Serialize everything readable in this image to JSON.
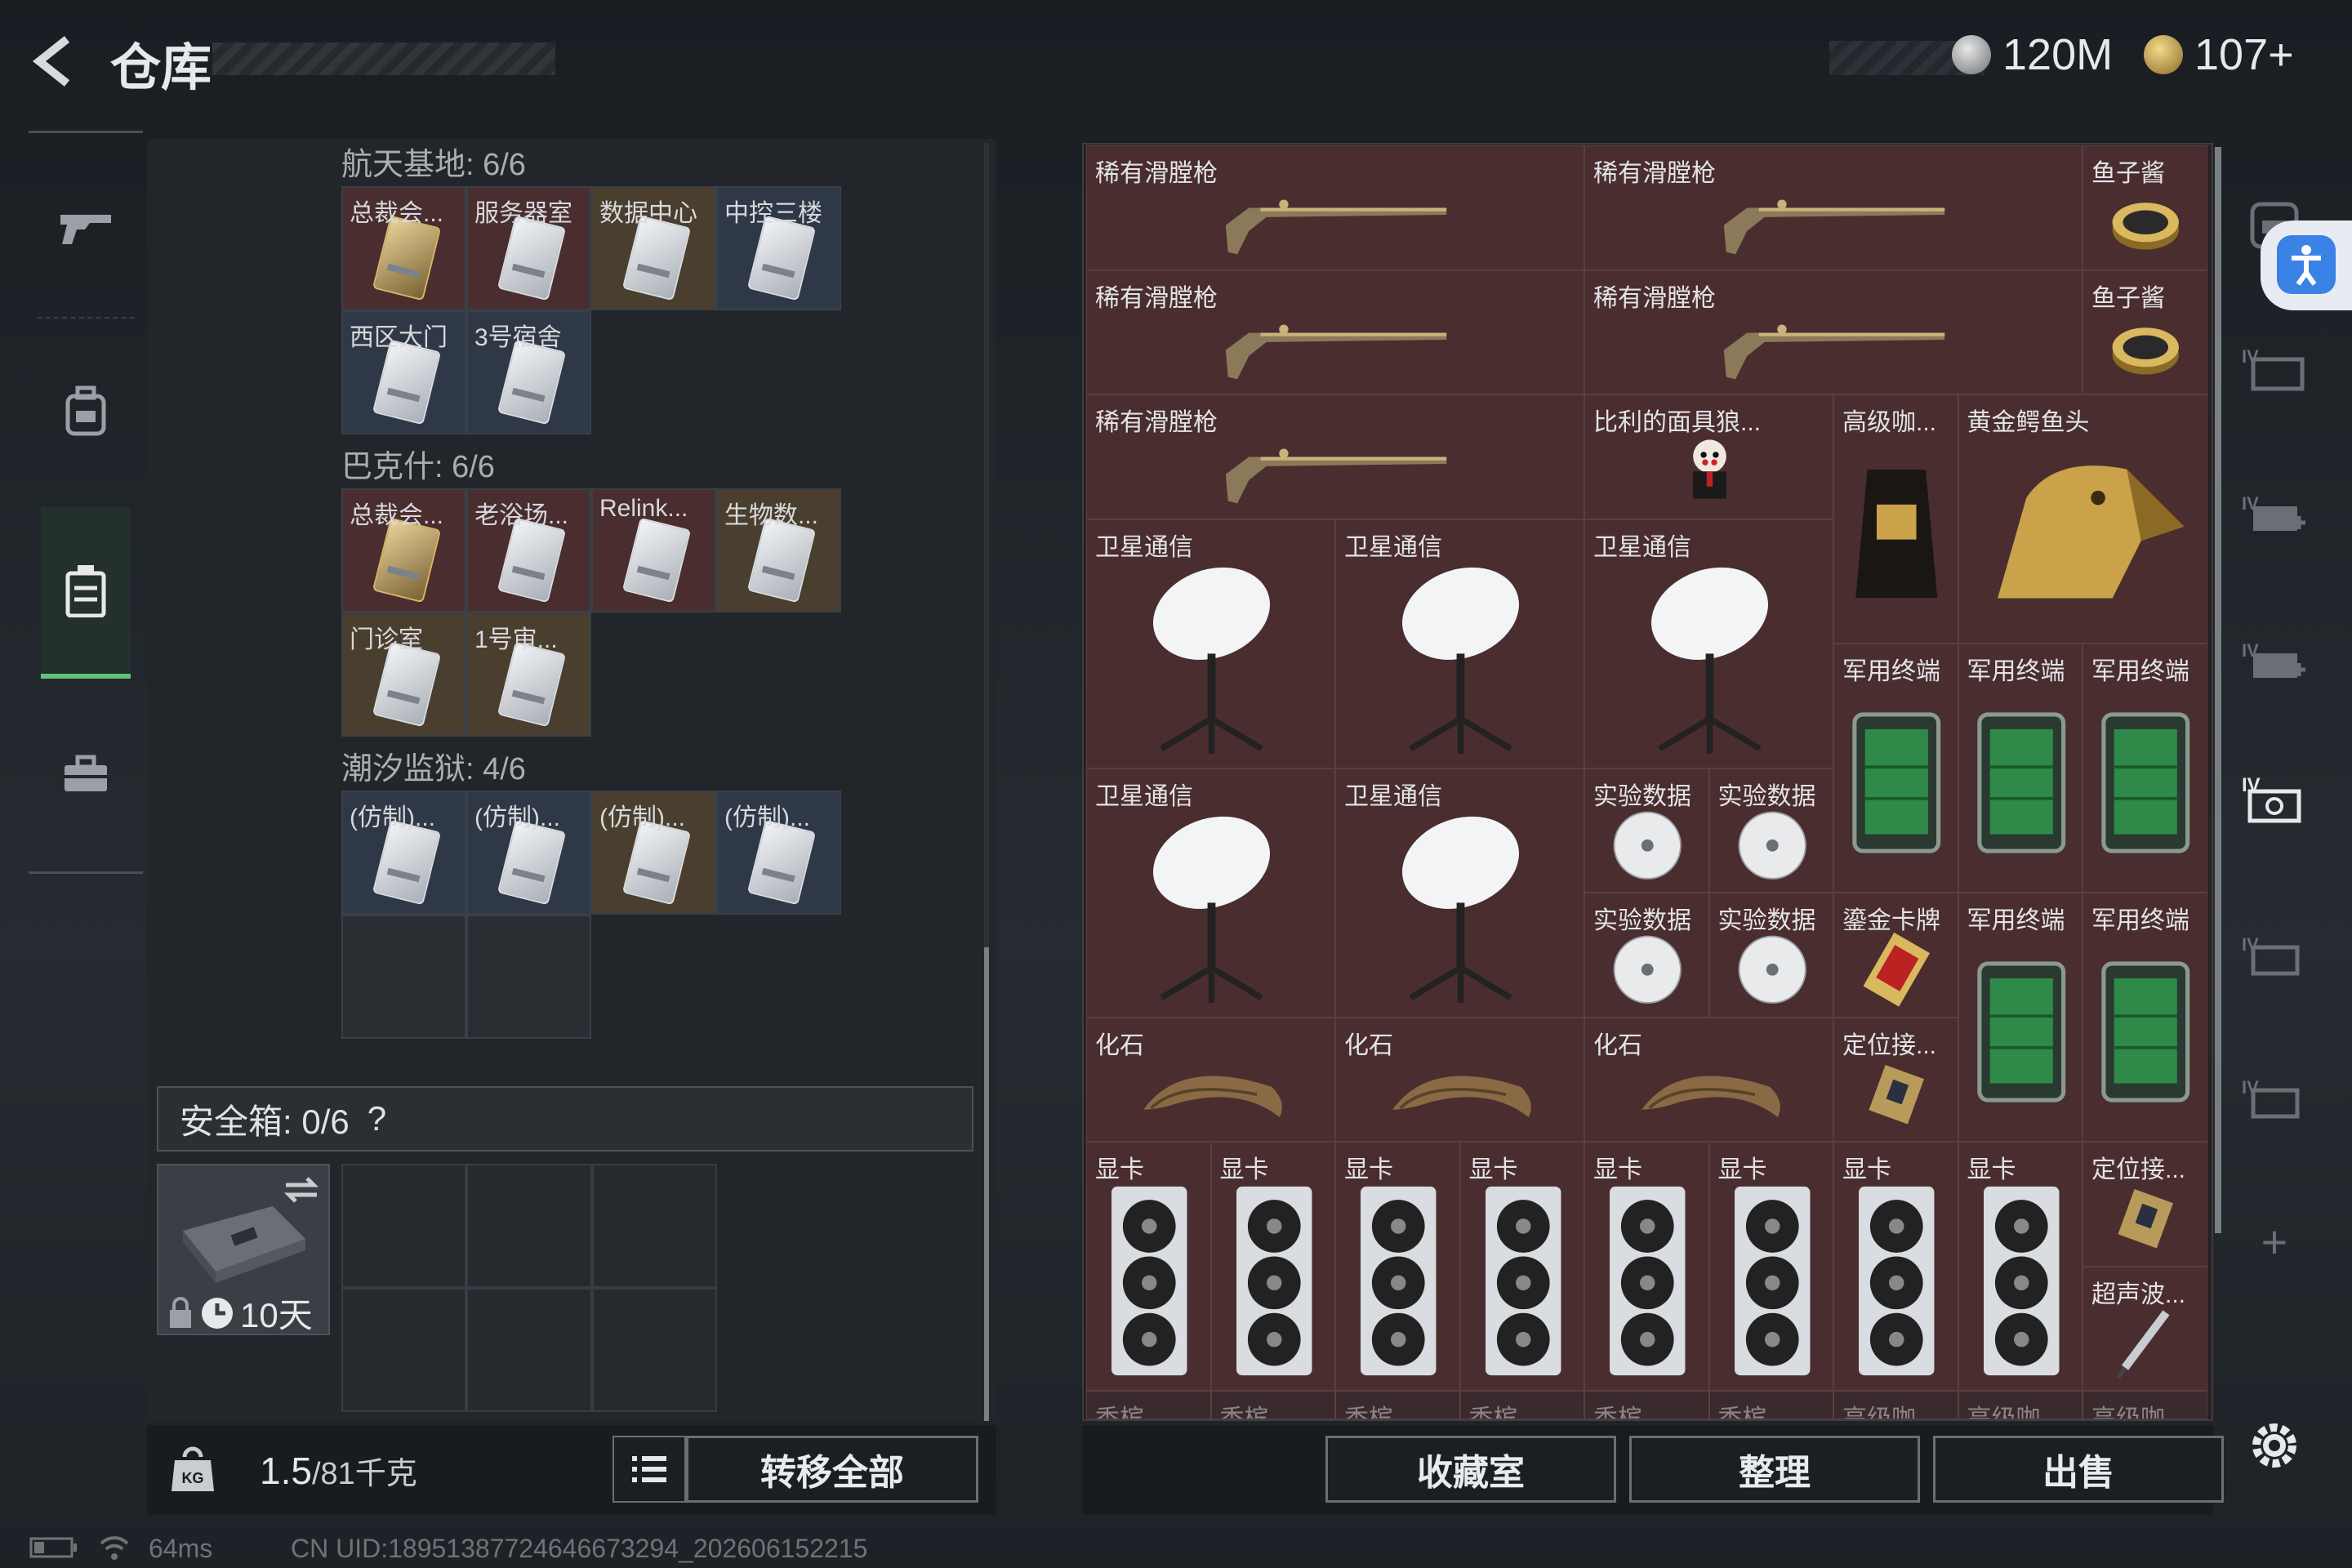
{
  "header": {
    "title": "仓库",
    "currency1": "120M",
    "currency2": "107+"
  },
  "left_nav": {
    "items": [
      "weapon-icon",
      "backpack-icon",
      "case-icon",
      "toolbox-icon"
    ]
  },
  "sections": [
    {
      "label": "航天基地: 6/6",
      "items": [
        {
          "name": "总裁会...",
          "color": "red",
          "card": "gold"
        },
        {
          "name": "服务器室",
          "color": "red",
          "card": "white"
        },
        {
          "name": "数据中心",
          "color": "gold",
          "card": "white"
        },
        {
          "name": "中控三楼",
          "color": "blue",
          "card": "white"
        },
        {
          "name": "西区大门",
          "color": "blue",
          "card": "white"
        },
        {
          "name": "3号宿舍",
          "color": "blue",
          "card": "white"
        }
      ]
    },
    {
      "label": "巴克什: 6/6",
      "items": [
        {
          "name": "总裁会...",
          "color": "red",
          "card": "gold"
        },
        {
          "name": "老浴场...",
          "color": "red",
          "card": "white"
        },
        {
          "name": "Relink...",
          "color": "red",
          "card": "white"
        },
        {
          "name": "生物数...",
          "color": "gold",
          "card": "white"
        },
        {
          "name": "门诊室",
          "color": "gold",
          "card": "white"
        },
        {
          "name": "1号审...",
          "color": "gold",
          "card": "white"
        }
      ]
    },
    {
      "label": "潮汐监狱: 4/6",
      "items": [
        {
          "name": "(仿制)...",
          "color": "blue",
          "card": "white"
        },
        {
          "name": "(仿制)...",
          "color": "blue",
          "card": "white"
        },
        {
          "name": "(仿制)...",
          "color": "gold",
          "card": "white"
        },
        {
          "name": "(仿制)...",
          "color": "blue",
          "card": "white"
        }
      ]
    }
  ],
  "safe": {
    "label": "安全箱: 0/6",
    "help": "?",
    "timer": "10天"
  },
  "weight": {
    "value": "1.5",
    "max": "/81千克"
  },
  "buttons": {
    "transfer_all": "转移全部",
    "collection": "收藏室",
    "organize": "整理",
    "sell": "出售"
  },
  "stash_items": [
    {
      "label": "稀有滑膛枪",
      "type": "rifle"
    },
    {
      "label": "稀有滑膛枪",
      "type": "rifle"
    },
    {
      "label": "鱼子酱",
      "type": "caviar"
    },
    {
      "label": "稀有滑膛枪",
      "type": "rifle"
    },
    {
      "label": "稀有滑膛枪",
      "type": "rifle"
    },
    {
      "label": "鱼子酱",
      "type": "caviar"
    },
    {
      "label": "稀有滑膛枪",
      "type": "rifle"
    },
    {
      "label": "比利的面具狼...",
      "type": "doll"
    },
    {
      "label": "高级咖...",
      "type": "coffee"
    },
    {
      "label": "黄金鳄鱼头",
      "type": "croc"
    },
    {
      "label": "卫星通信",
      "type": "dish"
    },
    {
      "label": "卫星通信",
      "type": "dish"
    },
    {
      "label": "卫星通信",
      "type": "dish"
    },
    {
      "label": "军用终端",
      "type": "terminal"
    },
    {
      "label": "军用终端",
      "type": "terminal"
    },
    {
      "label": "军用终端",
      "type": "terminal"
    },
    {
      "label": "卫星通信",
      "type": "dish"
    },
    {
      "label": "卫星通信",
      "type": "dish"
    },
    {
      "label": "实验数据",
      "type": "disc"
    },
    {
      "label": "实验数据",
      "type": "disc"
    },
    {
      "label": "实验数据",
      "type": "disc"
    },
    {
      "label": "实验数据",
      "type": "disc"
    },
    {
      "label": "鎏金卡牌",
      "type": "goldcard"
    },
    {
      "label": "军用终端",
      "type": "terminal"
    },
    {
      "label": "军用终端",
      "type": "terminal"
    },
    {
      "label": "化石",
      "type": "fossil"
    },
    {
      "label": "化石",
      "type": "fossil"
    },
    {
      "label": "化石",
      "type": "fossil"
    },
    {
      "label": "定位接...",
      "type": "locator"
    },
    {
      "label": "显卡",
      "type": "gpu"
    },
    {
      "label": "显卡",
      "type": "gpu"
    },
    {
      "label": "显卡",
      "type": "gpu"
    },
    {
      "label": "显卡",
      "type": "gpu"
    },
    {
      "label": "显卡",
      "type": "gpu"
    },
    {
      "label": "显卡",
      "type": "gpu"
    },
    {
      "label": "显卡",
      "type": "gpu"
    },
    {
      "label": "显卡",
      "type": "gpu"
    },
    {
      "label": "定位接...",
      "type": "locator"
    },
    {
      "label": "超声波...",
      "type": "ultrasonic"
    },
    {
      "label": "香槟",
      "type": "dim"
    },
    {
      "label": "香槟",
      "type": "dim"
    },
    {
      "label": "香槟",
      "type": "dim"
    },
    {
      "label": "香槟",
      "type": "dim"
    },
    {
      "label": "香槟",
      "type": "dim"
    },
    {
      "label": "香槟",
      "type": "dim"
    },
    {
      "label": "高级咖...",
      "type": "dim"
    },
    {
      "label": "高级咖...",
      "type": "dim"
    },
    {
      "label": "高级咖...",
      "type": "dim"
    }
  ],
  "right_nav": {
    "plus": "+"
  },
  "status": {
    "ping": "64ms",
    "uid": "CN UID:18951387724646673294_202606152215"
  },
  "colors": {
    "accent_green": "#5ec27d",
    "accessibility_blue": "#3a82e6"
  }
}
